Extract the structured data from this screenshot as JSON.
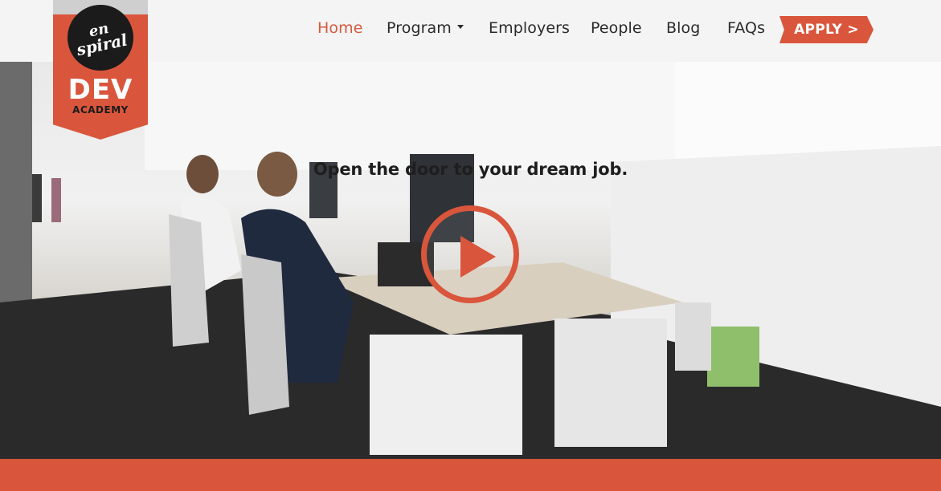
{
  "logo": {
    "circle_line1": "en",
    "circle_line2": "spiral",
    "title": "DEV",
    "subtitle": "ACADEMY"
  },
  "nav": {
    "items": [
      {
        "label": "Home",
        "active": true
      },
      {
        "label": "Program",
        "dropdown": true
      },
      {
        "label": "Employers"
      },
      {
        "label": "People"
      },
      {
        "label": "Blog"
      },
      {
        "label": "FAQs"
      }
    ],
    "apply_label": "APPLY >"
  },
  "hero": {
    "heading": "Open the door to your dream job.",
    "play_icon": "play-icon"
  },
  "colors": {
    "accent": "#d9563c",
    "header_bg": "#f4f4f4",
    "text": "#2b2b2b"
  }
}
